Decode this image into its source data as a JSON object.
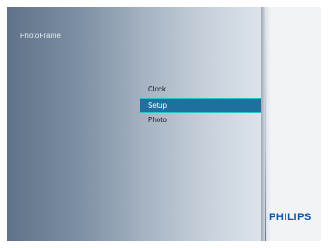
{
  "app": {
    "title": "PhotoFrame"
  },
  "menu": {
    "items": [
      {
        "label": "Clock",
        "selected": false
      },
      {
        "label": "Setup",
        "selected": true
      },
      {
        "label": "Photo",
        "selected": false
      }
    ]
  },
  "brand": {
    "name": "PHILIPS"
  },
  "colors": {
    "selection_bg": "#1f6f9f",
    "selection_border": "#27c2cf",
    "brand": "#0d56a8",
    "panel_left": "#5f7289",
    "panel_right": "#dce3ea"
  }
}
